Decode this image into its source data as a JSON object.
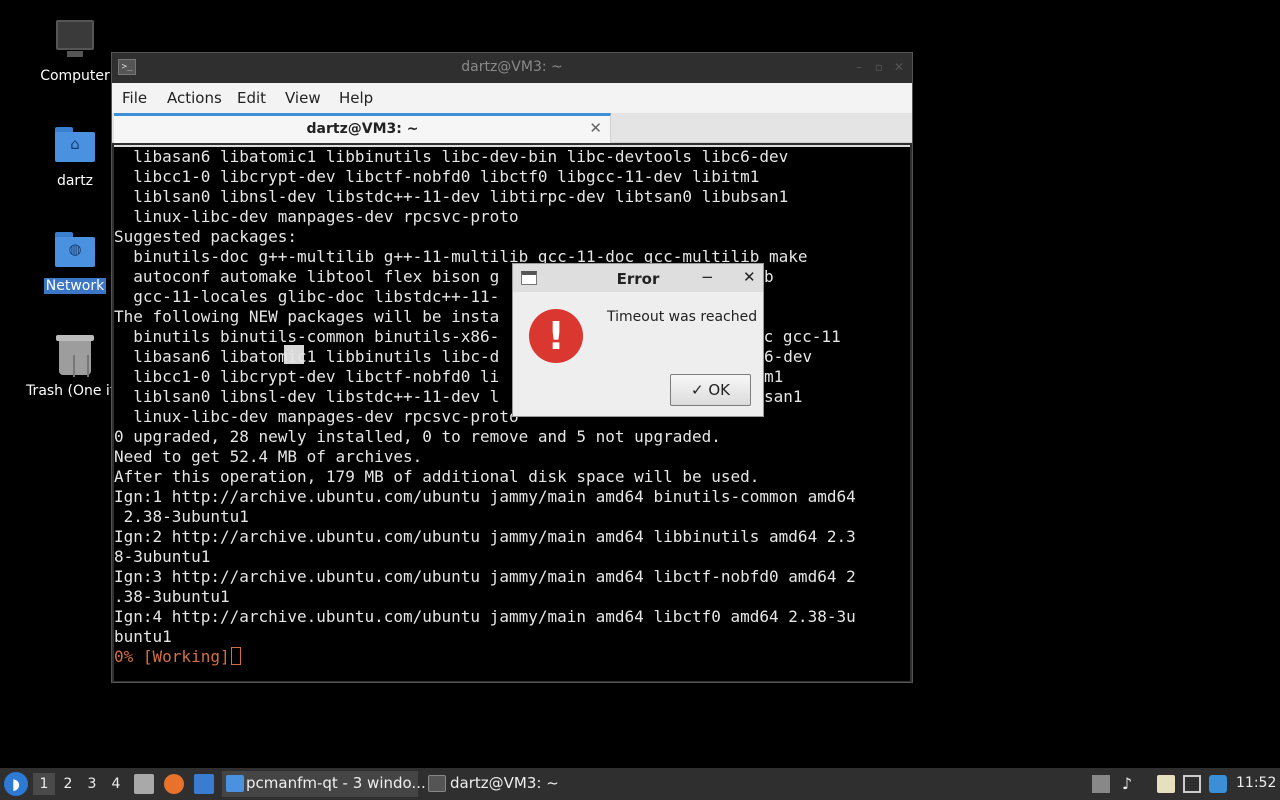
{
  "desktop": {
    "icons": [
      {
        "label": "Computer"
      },
      {
        "label": "dartz"
      },
      {
        "label": "Network"
      },
      {
        "label": "Trash (One ite"
      }
    ]
  },
  "terminal": {
    "window_title": "dartz@VM3: ~",
    "menu": [
      "File",
      "Actions",
      "Edit",
      "View",
      "Help"
    ],
    "tab_label": "dartz@VM3: ~",
    "lines": [
      "  libasan6 libatomic1 libbinutils libc-dev-bin libc-devtools libc6-dev",
      "  libcc1-0 libcrypt-dev libctf-nobfd0 libctf0 libgcc-11-dev libitm1",
      "  liblsan0 libnsl-dev libstdc++-11-dev libtirpc-dev libtsan0 libubsan1",
      "  linux-libc-dev manpages-dev rpcsvc-proto",
      "Suggested packages:",
      "  binutils-doc g++-multilib g++-11-multilib gcc-11-doc gcc-multilib make",
      "  autoconf automake libtool flex bison g",
      "  gcc-11-locales glibc-doc libstdc++-11-",
      "The following NEW packages will be insta",
      "  binutils binutils-common binutils-x86-",
      "  libasan6 libatomic1 libbinutils libc-d",
      "  libcc1-0 libcrypt-dev libctf-nobfd0 li",
      "  liblsan0 libnsl-dev libstdc++-11-dev l",
      "  linux-libc-dev manpages-dev rpcsvc-proto",
      "0 upgraded, 28 newly installed, 0 to remove and 5 not upgraded.",
      "Need to get 52.4 MB of archives.",
      "After this operation, 179 MB of additional disk space will be used.",
      "Ign:1 http://archive.ubuntu.com/ubuntu jammy/main amd64 binutils-common amd64",
      " 2.38-3ubuntu1",
      "Ign:2 http://archive.ubuntu.com/ubuntu jammy/main amd64 libbinutils amd64 2.3",
      "8-3ubuntu1",
      "Ign:3 http://archive.ubuntu.com/ubuntu jammy/main amd64 libctf-nobfd0 amd64 2",
      ".38-3ubuntu1",
      "Ign:4 http://archive.ubuntu.com/ubuntu jammy/main amd64 libctf0 amd64 2.38-3u",
      "buntu1"
    ],
    "progress_line": "0% [Working]",
    "right_fragments": [
      "b",
      "cc gcc-11",
      "6-dev",
      "m1",
      "san1"
    ]
  },
  "error_dialog": {
    "title": "Error",
    "minimize_glyph": "−",
    "close_glyph": "✕",
    "icon_glyph": "!",
    "message": "Timeout was reached",
    "ok_label": "✓ OK"
  },
  "taskbar": {
    "workspaces": [
      "1",
      "2",
      "3",
      "4"
    ],
    "tasks": [
      {
        "label": "pcmanfm-qt - 3 windo..."
      },
      {
        "label": "dartz@VM3: ~"
      }
    ],
    "clock": "11:52"
  },
  "colors": {
    "accent": "#3d8fd6",
    "progress_text": "#d4703f",
    "error_red": "#d93730",
    "selection": "#3b77c6"
  }
}
